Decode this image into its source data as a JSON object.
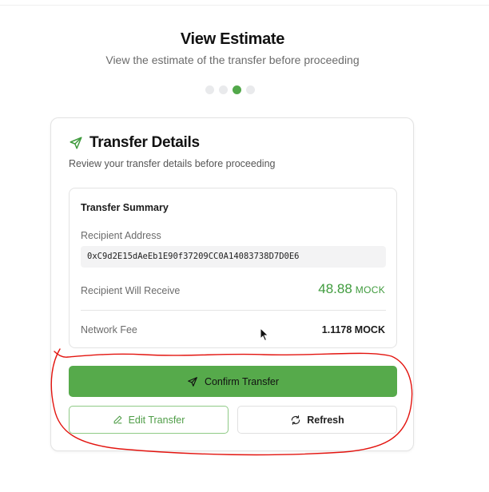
{
  "header": {
    "title": "View Estimate",
    "subtitle": "View the estimate of the transfer before proceeding"
  },
  "steps": {
    "total": 4,
    "current": 3
  },
  "card": {
    "icon": "send-icon",
    "title": "Transfer Details",
    "subtitle": "Review your transfer details before proceeding"
  },
  "summary": {
    "title": "Transfer Summary",
    "address_label": "Recipient Address",
    "address_value": "0xC9d2E15dAeEb1E90f37209CC0A14083738D7D0E6",
    "receive_label": "Recipient Will Receive",
    "receive_amount": "48.88",
    "receive_unit": "MOCK",
    "fee_label": "Network Fee",
    "fee_value": "1.1178 MOCK"
  },
  "actions": {
    "confirm_label": "Confirm Transfer",
    "edit_label": "Edit Transfer",
    "refresh_label": "Refresh"
  },
  "colors": {
    "accent": "#56aa4b",
    "accent_text": "#3f9b3d",
    "annotation": "#e3140f"
  }
}
